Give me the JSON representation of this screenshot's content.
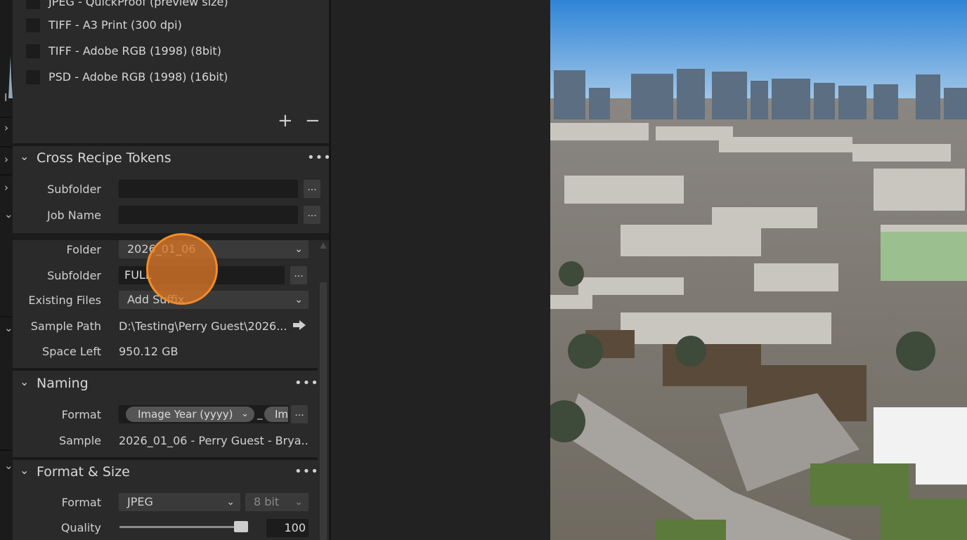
{
  "checklist": [
    {
      "label": "JPEG - QuickProof (preview size)"
    },
    {
      "label": "TIFF - A3 Print (300 dpi)"
    },
    {
      "label": "TIFF - Adobe RGB (1998) (8bit)"
    },
    {
      "label": "PSD - Adobe RGB (1998) (16bit)"
    }
  ],
  "list_controls": {
    "add": "+",
    "remove": "−"
  },
  "cross_recipe": {
    "title": "Cross Recipe Tokens",
    "more": "•••",
    "subfolder_label": "Subfolder",
    "subfolder_value": "",
    "jobname_label": "Job Name",
    "jobname_value": "",
    "browse": "..."
  },
  "location": {
    "folder_label": "Folder",
    "folder_value": "2026_01_06",
    "subfolder_label": "Subfolder",
    "subfolder_value": "FULL",
    "existing_label": "Existing Files",
    "existing_value": "Add Suffix",
    "sample_path_label": "Sample Path",
    "sample_path_value": "D:\\Testing\\Perry Guest\\2026...",
    "space_left_label": "Space Left",
    "space_left_value": "950.12 GB",
    "browse": "..."
  },
  "naming": {
    "title": "Naming",
    "more": "•••",
    "format_label": "Format",
    "token1": "Image Year (yyyy)",
    "separator": "_",
    "token2": "Im",
    "browse": "...",
    "sample_label": "Sample",
    "sample_value": "2026_01_06 - Perry Guest - Brya..."
  },
  "format_size": {
    "title": "Format & Size",
    "more": "•••",
    "format_label": "Format",
    "format_value": "JPEG",
    "bitdepth_value": "8 bit",
    "quality_label": "Quality",
    "quality_value": "100"
  },
  "quality_slider": {
    "value": 100,
    "min": 0,
    "max": 100
  },
  "colors": {
    "accent": "#f28c28",
    "panel": "#2a2a2a",
    "field": "#1c1c1c"
  }
}
